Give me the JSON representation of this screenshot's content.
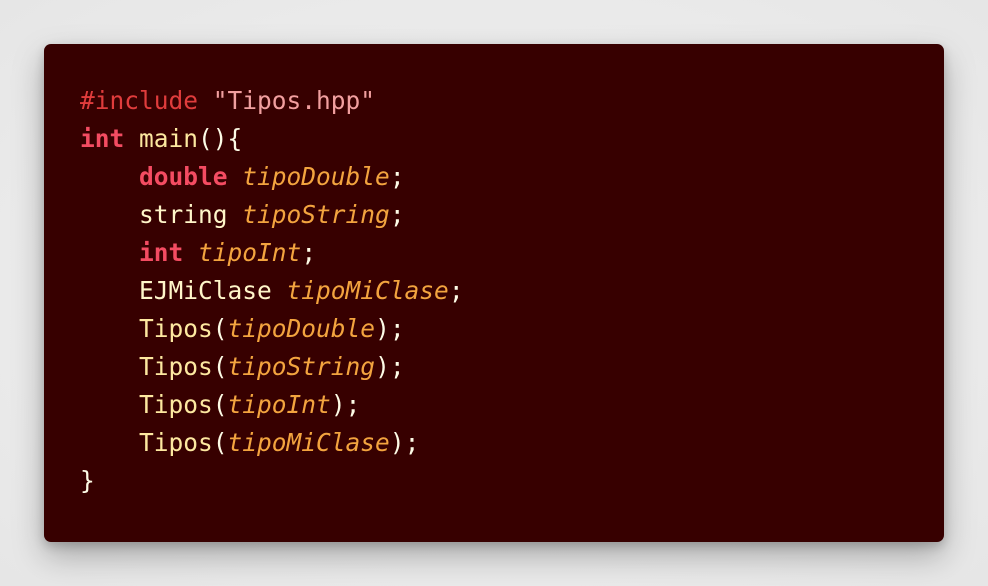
{
  "code": {
    "lines": [
      [
        {
          "text": "#include",
          "kind": "preproc"
        },
        {
          "text": " ",
          "kind": "space"
        },
        {
          "text": "\"Tipos.hpp\"",
          "kind": "string"
        }
      ],
      [
        {
          "text": "int",
          "kind": "keyword"
        },
        {
          "text": " ",
          "kind": "space"
        },
        {
          "text": "main",
          "kind": "func"
        },
        {
          "text": "(){",
          "kind": "punct"
        }
      ],
      [
        {
          "text": "    ",
          "kind": "space"
        },
        {
          "text": "double",
          "kind": "keyword"
        },
        {
          "text": " ",
          "kind": "space"
        },
        {
          "text": "tipoDouble",
          "kind": "var"
        },
        {
          "text": ";",
          "kind": "punct"
        }
      ],
      [
        {
          "text": "    ",
          "kind": "space"
        },
        {
          "text": "string",
          "kind": "type"
        },
        {
          "text": " ",
          "kind": "space"
        },
        {
          "text": "tipoString",
          "kind": "var"
        },
        {
          "text": ";",
          "kind": "punct"
        }
      ],
      [
        {
          "text": "    ",
          "kind": "space"
        },
        {
          "text": "int",
          "kind": "keyword"
        },
        {
          "text": " ",
          "kind": "space"
        },
        {
          "text": "tipoInt",
          "kind": "var"
        },
        {
          "text": ";",
          "kind": "punct"
        }
      ],
      [
        {
          "text": "    ",
          "kind": "space"
        },
        {
          "text": "EJMiClase",
          "kind": "type"
        },
        {
          "text": " ",
          "kind": "space"
        },
        {
          "text": "tipoMiClase",
          "kind": "var"
        },
        {
          "text": ";",
          "kind": "punct"
        }
      ],
      [
        {
          "text": "    ",
          "kind": "space"
        },
        {
          "text": "Tipos",
          "kind": "func"
        },
        {
          "text": "(",
          "kind": "punct"
        },
        {
          "text": "tipoDouble",
          "kind": "var"
        },
        {
          "text": ");",
          "kind": "punct"
        }
      ],
      [
        {
          "text": "    ",
          "kind": "space"
        },
        {
          "text": "Tipos",
          "kind": "func"
        },
        {
          "text": "(",
          "kind": "punct"
        },
        {
          "text": "tipoString",
          "kind": "var"
        },
        {
          "text": ");",
          "kind": "punct"
        }
      ],
      [
        {
          "text": "    ",
          "kind": "space"
        },
        {
          "text": "Tipos",
          "kind": "func"
        },
        {
          "text": "(",
          "kind": "punct"
        },
        {
          "text": "tipoInt",
          "kind": "var"
        },
        {
          "text": ");",
          "kind": "punct"
        }
      ],
      [
        {
          "text": "    ",
          "kind": "space"
        },
        {
          "text": "Tipos",
          "kind": "func"
        },
        {
          "text": "(",
          "kind": "punct"
        },
        {
          "text": "tipoMiClase",
          "kind": "var"
        },
        {
          "text": ");",
          "kind": "punct"
        }
      ],
      [
        {
          "text": "}",
          "kind": "punct"
        }
      ]
    ]
  },
  "colors": {
    "page_background": "#e9e9e9",
    "card_background": "#370000",
    "preprocessor": "#e03c3c",
    "string": "#f19f9f",
    "keyword": "#f44c62",
    "type": "#fff6c9",
    "function": "#fde8a0",
    "variable": "#f3a43f",
    "punctuation": "#fdfbe6"
  }
}
